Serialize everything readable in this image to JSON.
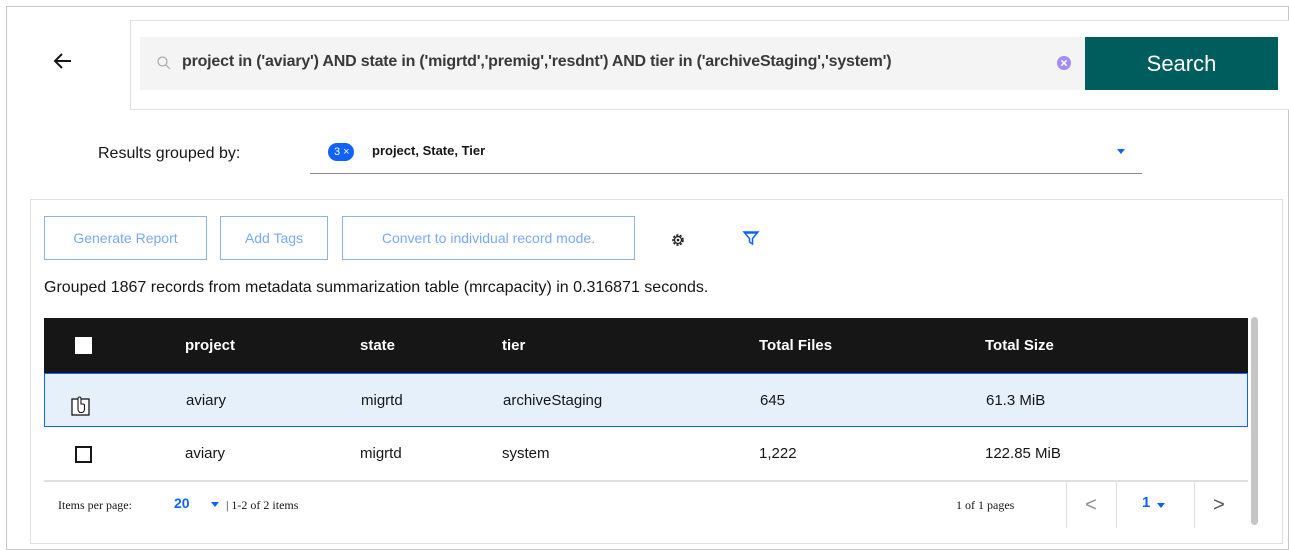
{
  "search": {
    "query": "project in ('aviary') AND state in ('migrtd','premig','resdnt') AND tier in ('archiveStaging','system')",
    "button_label": "Search"
  },
  "grouping": {
    "label": "Results grouped by:",
    "tag_count": "3",
    "tag_close": "×",
    "value": "project, State, Tier"
  },
  "toolbar": {
    "generate_report": "Generate Report",
    "add_tags": "Add Tags",
    "convert": "Convert to individual record mode."
  },
  "summary": "Grouped 1867 records from metadata summarization table (mrcapacity) in 0.316871 seconds.",
  "table": {
    "columns": [
      "project",
      "state",
      "tier",
      "Total Files",
      "Total Size"
    ],
    "rows": [
      {
        "project": "aviary",
        "state": "migrtd",
        "tier": "archiveStaging",
        "total_files": "645",
        "total_size": "61.3 MiB",
        "selected": true
      },
      {
        "project": "aviary",
        "state": "migrtd",
        "tier": "system",
        "total_files": "1,222",
        "total_size": "122.85 MiB",
        "selected": false
      }
    ]
  },
  "pagination": {
    "items_per_page_label": "Items per page:",
    "items_per_page": "20",
    "range": "| 1-2 of 2 items",
    "pages": "1 of 1 pages",
    "current_page": "1",
    "prev": "<",
    "next": ">"
  },
  "colors": {
    "accent": "#0f62fe",
    "search_button": "#005d5d",
    "header_bg": "#161616",
    "selected_row": "#e5f0fb"
  },
  "icons": [
    "back-arrow-icon",
    "search-icon",
    "clear-icon",
    "settings-gear-icon",
    "filter-icon",
    "hand-pointer-icon"
  ]
}
